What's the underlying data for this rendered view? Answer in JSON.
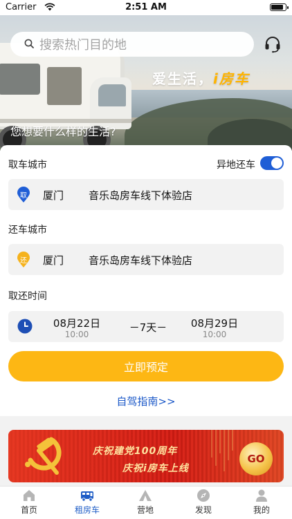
{
  "status_bar": {
    "carrier": "Carrier",
    "time": "2:51 AM"
  },
  "hero": {
    "search_placeholder": "搜索热门目的地",
    "slogan_prefix": "爱生活，",
    "slogan_accent": "i房车",
    "question": "您想要什么样的生活?"
  },
  "booking": {
    "pickup_label": "取车城市",
    "other_return_label": "异地还车",
    "other_return_enabled": true,
    "pickup": {
      "pin": "取",
      "city": "厦门",
      "store": "音乐岛房车线下体验店"
    },
    "return_label": "还车城市",
    "return": {
      "pin": "还",
      "city": "厦门",
      "store": "音乐岛房车线下体验店"
    },
    "time_label": "取还时间",
    "start": {
      "date": "08月22日",
      "time": "10:00"
    },
    "duration": "－7天－",
    "end": {
      "date": "08月29日",
      "time": "10:00"
    },
    "book_button": "立即预定",
    "guide_link": "自驾指南>>"
  },
  "banner": {
    "line1": "庆祝建党100周年",
    "line2": "庆祝i房车上线",
    "go": "GO"
  },
  "tabs": [
    {
      "label": "首页",
      "icon": "home-icon",
      "active": false
    },
    {
      "label": "租房车",
      "icon": "rv-icon",
      "active": true
    },
    {
      "label": "营地",
      "icon": "camp-icon",
      "active": false
    },
    {
      "label": "发现",
      "icon": "compass-icon",
      "active": false
    },
    {
      "label": "我的",
      "icon": "user-icon",
      "active": false
    }
  ],
  "colors": {
    "accent_blue": "#1e5cc6",
    "button_yellow": "#fdb714",
    "pickup_pin": "#1f5ed6",
    "return_pin": "#f5b21c"
  }
}
